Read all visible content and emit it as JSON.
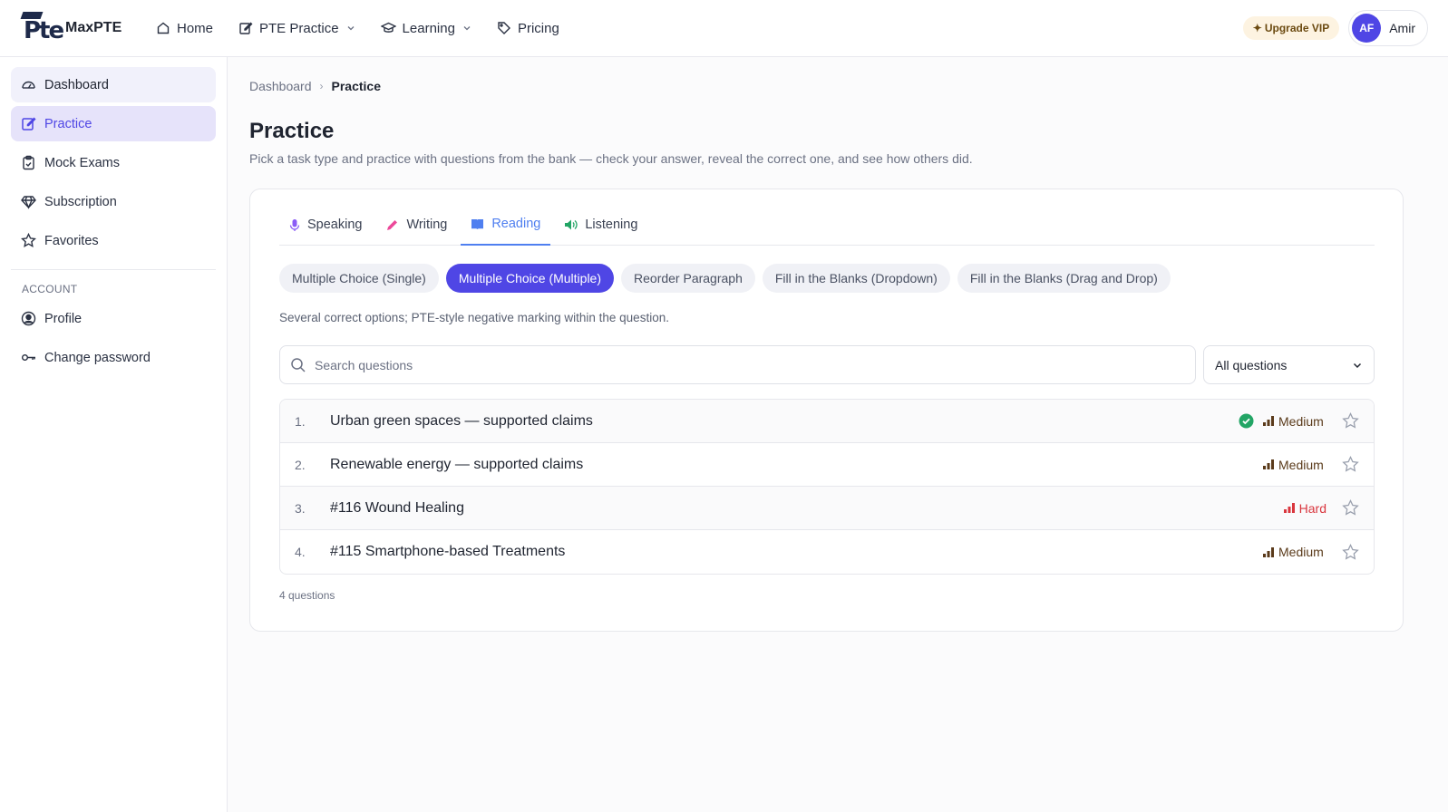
{
  "header": {
    "brand": "MaxPTE",
    "logo_text": "Pte",
    "nav": [
      {
        "label": "Home",
        "icon": "home-icon"
      },
      {
        "label": "PTE Practice",
        "icon": "edit-icon",
        "dropdown": true
      },
      {
        "label": "Learning",
        "icon": "graduation-cap-icon",
        "dropdown": true
      },
      {
        "label": "Pricing",
        "icon": "tag-icon"
      }
    ],
    "upgrade_label": "Upgrade VIP",
    "user": {
      "initials": "AF",
      "name": "Amir"
    }
  },
  "sidebar": {
    "items": [
      {
        "label": "Dashboard",
        "icon": "dashboard-gauge-icon"
      },
      {
        "label": "Practice",
        "icon": "edit-icon",
        "active": true
      },
      {
        "label": "Mock Exams",
        "icon": "clipboard-icon"
      },
      {
        "label": "Subscription",
        "icon": "diamond-icon"
      },
      {
        "label": "Favorites",
        "icon": "star-icon"
      }
    ],
    "account_section": "ACCOUNT",
    "account_items": [
      {
        "label": "Profile",
        "icon": "user-circle-icon"
      },
      {
        "label": "Change password",
        "icon": "key-icon"
      }
    ]
  },
  "breadcrumb": {
    "root": "Dashboard",
    "current": "Practice"
  },
  "page": {
    "title": "Practice",
    "subtitle": "Pick a task type and practice with questions from the bank — check your answer, reveal the correct one, and see how others did."
  },
  "tabs": [
    {
      "label": "Speaking",
      "icon": "microphone-icon"
    },
    {
      "label": "Writing",
      "icon": "pencil-icon"
    },
    {
      "label": "Reading",
      "icon": "book-icon",
      "active": true
    },
    {
      "label": "Listening",
      "icon": "speaker-icon"
    }
  ],
  "task_types": [
    {
      "label": "Multiple Choice (Single)"
    },
    {
      "label": "Multiple Choice (Multiple)",
      "active": true
    },
    {
      "label": "Reorder Paragraph"
    },
    {
      "label": "Fill in the Blanks (Dropdown)"
    },
    {
      "label": "Fill in the Blanks (Drag and Drop)"
    }
  ],
  "task_description": "Several correct options; PTE-style negative marking within the question.",
  "search": {
    "placeholder": "Search questions",
    "value": ""
  },
  "filter": {
    "selected": "All questions"
  },
  "questions": [
    {
      "num": "1.",
      "title": "Urban green spaces — supported claims",
      "completed": true,
      "difficulty": "Medium"
    },
    {
      "num": "2.",
      "title": "Renewable energy — supported claims",
      "completed": false,
      "difficulty": "Medium"
    },
    {
      "num": "3.",
      "title": "#116 Wound Healing",
      "completed": false,
      "difficulty": "Hard"
    },
    {
      "num": "4.",
      "title": "#115 Smartphone-based Treatments",
      "completed": false,
      "difficulty": "Medium"
    }
  ],
  "question_count": "4 questions",
  "colors": {
    "accent": "#4f46e5",
    "tab_active": "#4f7ff0",
    "hard": "#d9363e",
    "medium": "#5a3a1a",
    "done": "#22a565"
  }
}
